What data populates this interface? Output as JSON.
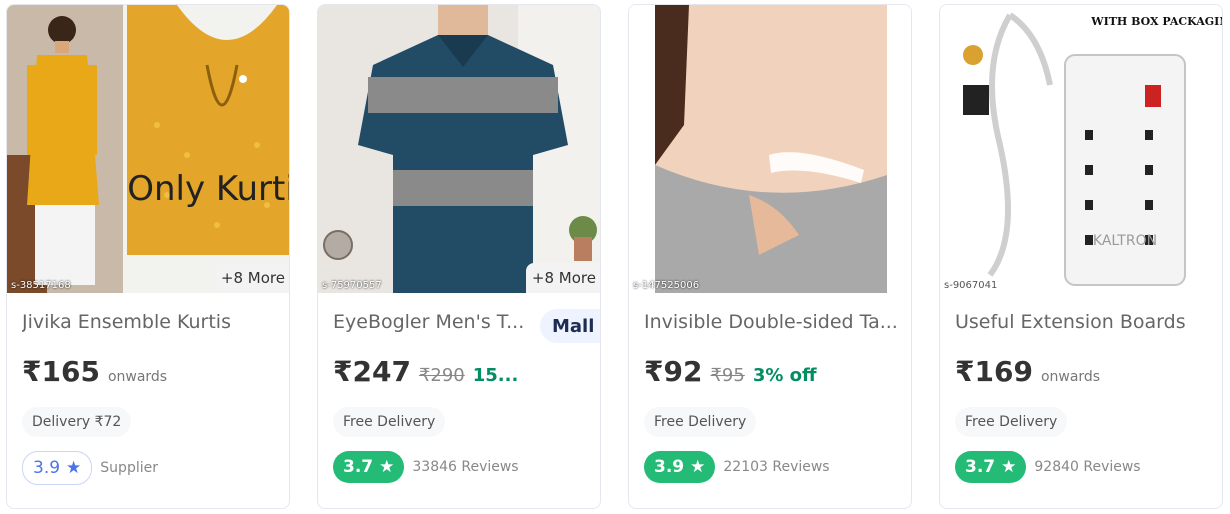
{
  "products": [
    {
      "title": "Jivika Ensemble Kurtis",
      "price": "₹165",
      "suffix": "onwards",
      "mrp": "",
      "discount": "",
      "delivery": "Delivery ₹72",
      "rating": "3.9",
      "reviews": "Supplier",
      "more": "+8 More",
      "sku": "s-38517168",
      "image_text": "Only Kurti",
      "icon": "star-icon"
    },
    {
      "title": "EyeBogler Men's T...",
      "price": "₹247",
      "suffix": "",
      "mrp": "₹290",
      "discount": "15...",
      "delivery": "Free Delivery",
      "rating": "3.7",
      "reviews": "33846 Reviews",
      "more": "+8 More",
      "sku": "s-75970557",
      "mall": "Mall",
      "icon": "star-icon"
    },
    {
      "title": "Invisible Double-sided Ta...",
      "price": "₹92",
      "suffix": "",
      "mrp": "₹95",
      "discount": "3% off",
      "delivery": "Free Delivery",
      "rating": "3.9",
      "reviews": "22103 Reviews",
      "sku": "s-147525006",
      "icon": "star-icon"
    },
    {
      "title": "Useful Extension Boards",
      "price": "₹169",
      "suffix": "onwards",
      "mrp": "",
      "discount": "",
      "delivery": "Free Delivery",
      "rating": "3.7",
      "reviews": "92840 Reviews",
      "sku": "s-9067041",
      "image_text": "WITH BOX PACKAGING",
      "brand_text": "KALTRON",
      "icon": "star-icon"
    }
  ],
  "colors": {
    "rating_green": "#23bb75",
    "discount_green": "#038d63",
    "rating_outline_blue": "#4a74e8"
  }
}
